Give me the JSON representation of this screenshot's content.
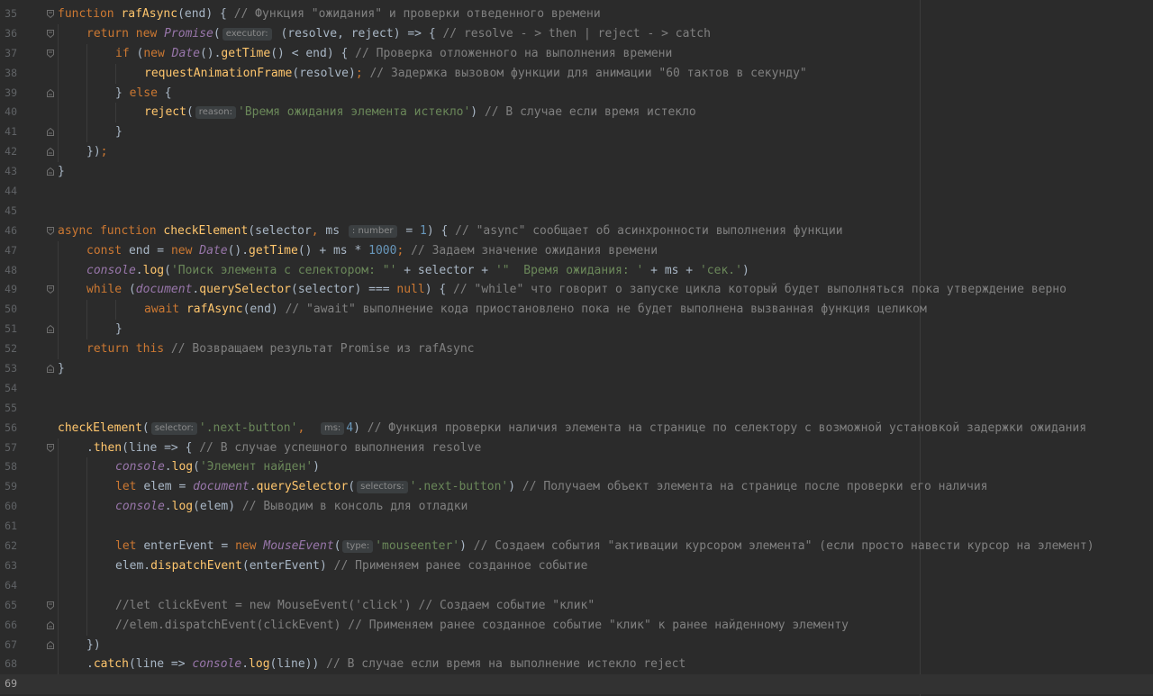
{
  "editor": {
    "first_line_number": 35,
    "current_line_number": 69,
    "colors": {
      "background": "#2b2b2b",
      "keyword": "#cc7832",
      "function": "#ffc66d",
      "class": "#9876aa",
      "string": "#6a8759",
      "number": "#6897bb",
      "comment": "#808080",
      "default": "#a9b7c6"
    },
    "lines": [
      {
        "n": "35",
        "indent": 0,
        "fold": "start",
        "t": [
          [
            "kw",
            "function "
          ],
          [
            "fn",
            "rafAsync"
          ],
          [
            "p",
            "(end) { "
          ],
          [
            "cm",
            "// Функция \"ожидания\" и проверки отведенного времени"
          ]
        ]
      },
      {
        "n": "36",
        "indent": 1,
        "fold": "start",
        "t": [
          [
            "kw",
            "return new "
          ],
          [
            "cls",
            "Promise"
          ],
          [
            "p",
            "("
          ],
          [
            "hint",
            "executor:"
          ],
          [
            "p",
            " (resolve, reject) => { "
          ],
          [
            "cm",
            "// resolve - > then | reject - > catch"
          ]
        ]
      },
      {
        "n": "37",
        "indent": 2,
        "fold": "start",
        "t": [
          [
            "kw",
            "if "
          ],
          [
            "p",
            "("
          ],
          [
            "kw",
            "new "
          ],
          [
            "cls",
            "Date"
          ],
          [
            "p",
            "()."
          ],
          [
            "fn",
            "getTime"
          ],
          [
            "p",
            "() < end) { "
          ],
          [
            "cm",
            "// Проверка отложенного на выполнения времени"
          ]
        ]
      },
      {
        "n": "38",
        "indent": 3,
        "fold": "",
        "t": [
          [
            "fn",
            "requestAnimationFrame"
          ],
          [
            "p",
            "(resolve)"
          ],
          [
            "kw",
            ";"
          ],
          [
            "p",
            " "
          ],
          [
            "cm",
            "// Задержка вызовом функции для анимации \"60 тактов в секунду\""
          ]
        ]
      },
      {
        "n": "39",
        "indent": 2,
        "fold": "end",
        "t": [
          [
            "p",
            "} "
          ],
          [
            "kw",
            "else "
          ],
          [
            "p",
            "{"
          ]
        ]
      },
      {
        "n": "40",
        "indent": 3,
        "fold": "",
        "t": [
          [
            "fn",
            "reject"
          ],
          [
            "p",
            "("
          ],
          [
            "hint",
            "reason:"
          ],
          [
            "str",
            "'Время ожидания элемента истекло'"
          ],
          [
            "p",
            ") "
          ],
          [
            "cm",
            "// В случае если время истекло"
          ]
        ]
      },
      {
        "n": "41",
        "indent": 2,
        "fold": "end",
        "t": [
          [
            "p",
            "}"
          ]
        ]
      },
      {
        "n": "42",
        "indent": 1,
        "fold": "end",
        "t": [
          [
            "p",
            "})"
          ],
          [
            "kw",
            ";"
          ]
        ]
      },
      {
        "n": "43",
        "indent": 0,
        "fold": "end",
        "t": [
          [
            "p",
            "}"
          ]
        ]
      },
      {
        "n": "44",
        "indent": 0,
        "fold": "",
        "t": []
      },
      {
        "n": "45",
        "indent": 0,
        "fold": "",
        "t": []
      },
      {
        "n": "46",
        "indent": 0,
        "fold": "start",
        "t": [
          [
            "kw",
            "async function "
          ],
          [
            "fn",
            "checkElement"
          ],
          [
            "p",
            "(selector"
          ],
          [
            "kw",
            ","
          ],
          [
            "p",
            " ms "
          ],
          [
            "hint",
            ": number"
          ],
          [
            "p",
            " = "
          ],
          [
            "num",
            "1"
          ],
          [
            "p",
            ") { "
          ],
          [
            "cm",
            "// \"async\" сообщает об асинхронности выполнения функции"
          ]
        ]
      },
      {
        "n": "47",
        "indent": 1,
        "fold": "",
        "t": [
          [
            "kw",
            "const "
          ],
          [
            "p",
            "end = "
          ],
          [
            "kw",
            "new "
          ],
          [
            "cls",
            "Date"
          ],
          [
            "p",
            "()."
          ],
          [
            "fn",
            "getTime"
          ],
          [
            "p",
            "() + ms * "
          ],
          [
            "num",
            "1000"
          ],
          [
            "kw",
            ";"
          ],
          [
            "p",
            " "
          ],
          [
            "cm",
            "// Задаем значение ожидания времени"
          ]
        ]
      },
      {
        "n": "48",
        "indent": 1,
        "fold": "",
        "t": [
          [
            "obj",
            "console"
          ],
          [
            "p",
            "."
          ],
          [
            "fn",
            "log"
          ],
          [
            "p",
            "("
          ],
          [
            "str",
            "'Поиск элемента с селектором: \"'"
          ],
          [
            "p",
            " + selector + "
          ],
          [
            "str",
            "'\"  Время ожидания: '"
          ],
          [
            "p",
            " + ms + "
          ],
          [
            "str",
            "'сек.'"
          ],
          [
            "p",
            ")"
          ]
        ]
      },
      {
        "n": "49",
        "indent": 1,
        "fold": "start",
        "t": [
          [
            "kw",
            "while "
          ],
          [
            "p",
            "("
          ],
          [
            "obj",
            "document"
          ],
          [
            "p",
            "."
          ],
          [
            "fn",
            "querySelector"
          ],
          [
            "p",
            "(selector) === "
          ],
          [
            "kw",
            "null"
          ],
          [
            "p",
            ") { "
          ],
          [
            "cm",
            "// \"while\" что говорит о запуске цикла который будет выполняться пока утверждение верно"
          ]
        ]
      },
      {
        "n": "50",
        "indent": 3,
        "fold": "",
        "t": [
          [
            "kw",
            "await "
          ],
          [
            "fn",
            "rafAsync"
          ],
          [
            "p",
            "(end) "
          ],
          [
            "cm",
            "// \"await\" выполнение кода приостановлено пока не будет выполнена вызванная функция целиком"
          ]
        ]
      },
      {
        "n": "51",
        "indent": 2,
        "fold": "end",
        "t": [
          [
            "p",
            "}"
          ]
        ]
      },
      {
        "n": "52",
        "indent": 1,
        "fold": "",
        "t": [
          [
            "kw",
            "return this "
          ],
          [
            "cm",
            "// Возвращаем результат Promise из rafAsync"
          ]
        ]
      },
      {
        "n": "53",
        "indent": 0,
        "fold": "end",
        "t": [
          [
            "p",
            "}"
          ]
        ]
      },
      {
        "n": "54",
        "indent": 0,
        "fold": "",
        "t": []
      },
      {
        "n": "55",
        "indent": 0,
        "fold": "",
        "t": []
      },
      {
        "n": "56",
        "indent": 0,
        "fold": "",
        "t": [
          [
            "fn",
            "checkElement"
          ],
          [
            "p",
            "("
          ],
          [
            "hint",
            "selector:"
          ],
          [
            "str",
            "'.next-button'"
          ],
          [
            "kw",
            ","
          ],
          [
            "p",
            "  "
          ],
          [
            "hint",
            "ms:"
          ],
          [
            "num",
            "4"
          ],
          [
            "p",
            ") "
          ],
          [
            "cm",
            "// Функция проверки наличия элемента на странице по селектору с возможной установкой задержки ожидания"
          ]
        ]
      },
      {
        "n": "57",
        "indent": 1,
        "fold": "start",
        "t": [
          [
            "p",
            "."
          ],
          [
            "fn",
            "then"
          ],
          [
            "p",
            "(line => { "
          ],
          [
            "cm",
            "// В случае успешного выполнения resolve"
          ]
        ]
      },
      {
        "n": "58",
        "indent": 2,
        "fold": "",
        "t": [
          [
            "obj",
            "console"
          ],
          [
            "p",
            "."
          ],
          [
            "fn",
            "log"
          ],
          [
            "p",
            "("
          ],
          [
            "str",
            "'Элемент найден'"
          ],
          [
            "p",
            ")"
          ]
        ]
      },
      {
        "n": "59",
        "indent": 2,
        "fold": "",
        "t": [
          [
            "kw",
            "let "
          ],
          [
            "p",
            "elem = "
          ],
          [
            "obj",
            "document"
          ],
          [
            "p",
            "."
          ],
          [
            "fn",
            "querySelector"
          ],
          [
            "p",
            "("
          ],
          [
            "hint",
            "selectors:"
          ],
          [
            "str",
            "'.next-button'"
          ],
          [
            "p",
            ") "
          ],
          [
            "cm",
            "// Получаем объект элемента на странице после проверки его наличия"
          ]
        ]
      },
      {
        "n": "60",
        "indent": 2,
        "fold": "",
        "t": [
          [
            "obj",
            "console"
          ],
          [
            "p",
            "."
          ],
          [
            "fn",
            "log"
          ],
          [
            "p",
            "(elem) "
          ],
          [
            "cm",
            "// Выводим в консоль для отладки"
          ]
        ]
      },
      {
        "n": "61",
        "indent": 2,
        "fold": "",
        "t": []
      },
      {
        "n": "62",
        "indent": 2,
        "fold": "",
        "t": [
          [
            "kw",
            "let "
          ],
          [
            "p",
            "enterEvent = "
          ],
          [
            "kw",
            "new "
          ],
          [
            "cls",
            "MouseEvent"
          ],
          [
            "p",
            "("
          ],
          [
            "hint",
            "type:"
          ],
          [
            "str",
            "'mouseenter'"
          ],
          [
            "p",
            ") "
          ],
          [
            "cm",
            "// Создаем события \"активации курсором элемента\" (если просто навести курсор на элемент)"
          ]
        ]
      },
      {
        "n": "63",
        "indent": 2,
        "fold": "",
        "t": [
          [
            "p",
            "elem."
          ],
          [
            "fn",
            "dispatchEvent"
          ],
          [
            "p",
            "(enterEvent) "
          ],
          [
            "cm",
            "// Применяем ранее созданное событие"
          ]
        ]
      },
      {
        "n": "64",
        "indent": 2,
        "fold": "",
        "t": []
      },
      {
        "n": "65",
        "indent": 2,
        "fold": "start",
        "t": [
          [
            "cm",
            "//let clickEvent = new MouseEvent('click') // Создаем событие \"клик\""
          ]
        ]
      },
      {
        "n": "66",
        "indent": 2,
        "fold": "end",
        "t": [
          [
            "cm",
            "//elem.dispatchEvent(clickEvent) // Применяем ранее созданное событие \"клик\" к ранее найденному элементу"
          ]
        ]
      },
      {
        "n": "67",
        "indent": 1,
        "fold": "end",
        "t": [
          [
            "p",
            "})"
          ]
        ]
      },
      {
        "n": "68",
        "indent": 1,
        "fold": "",
        "t": [
          [
            "p",
            "."
          ],
          [
            "fn",
            "catch"
          ],
          [
            "p",
            "(line => "
          ],
          [
            "obj",
            "console"
          ],
          [
            "p",
            "."
          ],
          [
            "fn",
            "log"
          ],
          [
            "p",
            "(line)) "
          ],
          [
            "cm",
            "// В случае если время на выполнение истекло reject"
          ]
        ]
      },
      {
        "n": "69",
        "indent": 0,
        "fold": "",
        "t": []
      }
    ]
  }
}
